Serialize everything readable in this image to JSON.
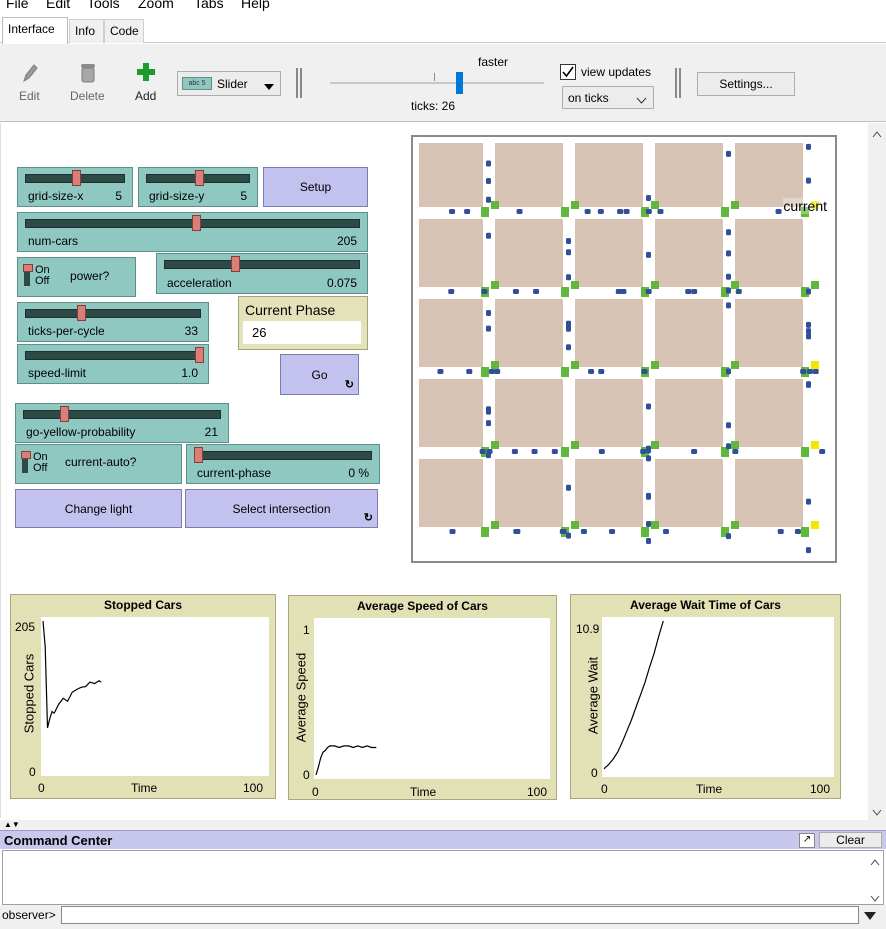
{
  "menu": [
    "File",
    "Edit",
    "Tools",
    "Zoom",
    "Tabs",
    "Help"
  ],
  "tabs": [
    "Interface",
    "Info",
    "Code"
  ],
  "toolbar": {
    "edit_label": "Edit",
    "delete_label": "Delete",
    "add_label": "Add",
    "widget_type": "Slider",
    "widget_icon_text": "abc 5",
    "speed_label": "faster",
    "ticks_label": "ticks: 26",
    "view_updates_label": "view updates",
    "view_updates_checked": true,
    "update_mode": "on ticks",
    "settings_label": "Settings..."
  },
  "widgets": {
    "grid_size_x": {
      "label": "grid-size-x",
      "value": "5",
      "fraction": 0.5
    },
    "grid_size_y": {
      "label": "grid-size-y",
      "value": "5",
      "fraction": 0.5
    },
    "setup": "Setup",
    "num_cars": {
      "label": "num-cars",
      "value": "205",
      "fraction": 0.5
    },
    "power": {
      "label": "power?",
      "on": "On",
      "off": "Off",
      "state": "on"
    },
    "acceleration": {
      "label": "acceleration",
      "value": "0.075",
      "fraction": 0.35
    },
    "ticks_per_cycle": {
      "label": "ticks-per-cycle",
      "value": "33",
      "fraction": 0.3
    },
    "current_phase_monitor": {
      "label": "Current Phase",
      "value": "26"
    },
    "speed_limit": {
      "label": "speed-limit",
      "value": "1.0",
      "fraction": 1.0
    },
    "go": "Go",
    "go_yellow_probability": {
      "label": "go-yellow-probability",
      "value": "21",
      "fraction": 0.21
    },
    "current_auto": {
      "label": "current-auto?",
      "on": "On",
      "off": "Off",
      "state": "on"
    },
    "current_phase": {
      "label": "current-phase",
      "value": "0 %",
      "fraction": 0.0
    },
    "change_light": "Change light",
    "select_intersection": "Select intersection"
  },
  "world": {
    "label": "current",
    "road_color": "#ffffff",
    "block_color": "#d6c3b4",
    "signal_green": "#5fb83a",
    "signal_yellow": "#f2e800",
    "car_color": "#2f4f9a"
  },
  "plots": [
    {
      "title": "Stopped Cars",
      "ylabel": "Stopped Cars",
      "xlabel": "Time",
      "ymax": "205",
      "ymin": "0",
      "xmin": "0",
      "xmax": "100"
    },
    {
      "title": "Average Speed of Cars",
      "ylabel": "Average Speed",
      "xlabel": "Time",
      "ymax": "1",
      "ymin": "0",
      "xmin": "0",
      "xmax": "100"
    },
    {
      "title": "Average Wait Time of Cars",
      "ylabel": "Average Wait",
      "xlabel": "Time",
      "ymax": "10.9",
      "ymin": "0",
      "xmin": "0",
      "xmax": "100"
    }
  ],
  "chart_data": [
    {
      "type": "line",
      "title": "Stopped Cars",
      "xlabel": "Time",
      "ylabel": "Stopped Cars",
      "xlim": [
        0,
        100
      ],
      "ylim": [
        0,
        205
      ],
      "series": [
        {
          "x": [
            0,
            1,
            2,
            3,
            4,
            5,
            7,
            9,
            11,
            13,
            15,
            17,
            19,
            21,
            23,
            25,
            26
          ],
          "y": [
            205,
            170,
            60,
            72,
            82,
            80,
            92,
            100,
            96,
            108,
            112,
            115,
            116,
            122,
            120,
            124,
            122
          ]
        }
      ]
    },
    {
      "type": "line",
      "title": "Average Speed of Cars",
      "xlabel": "Time",
      "ylabel": "Average Speed",
      "xlim": [
        0,
        100
      ],
      "ylim": [
        0,
        1
      ],
      "series": [
        {
          "x": [
            0,
            1,
            2,
            3,
            4,
            5,
            6,
            8,
            10,
            12,
            14,
            16,
            18,
            20,
            22,
            24,
            26
          ],
          "y": [
            0.0,
            0.05,
            0.11,
            0.15,
            0.16,
            0.18,
            0.19,
            0.19,
            0.18,
            0.19,
            0.19,
            0.18,
            0.19,
            0.18,
            0.19,
            0.18,
            0.18
          ]
        }
      ]
    },
    {
      "type": "line",
      "title": "Average Wait Time of Cars",
      "xlabel": "Time",
      "ylabel": "Average Wait",
      "xlim": [
        0,
        100
      ],
      "ylim": [
        0,
        10.9
      ],
      "series": [
        {
          "x": [
            0,
            2,
            4,
            6,
            8,
            10,
            12,
            14,
            16,
            18,
            20,
            22,
            24,
            26
          ],
          "y": [
            0.3,
            0.6,
            1.0,
            1.5,
            2.2,
            3.0,
            3.8,
            4.7,
            5.6,
            6.5,
            7.6,
            8.6,
            9.8,
            10.9
          ]
        }
      ]
    }
  ],
  "command_center": {
    "title": "Command Center",
    "clear_label": "Clear",
    "prompt": "observer>"
  }
}
